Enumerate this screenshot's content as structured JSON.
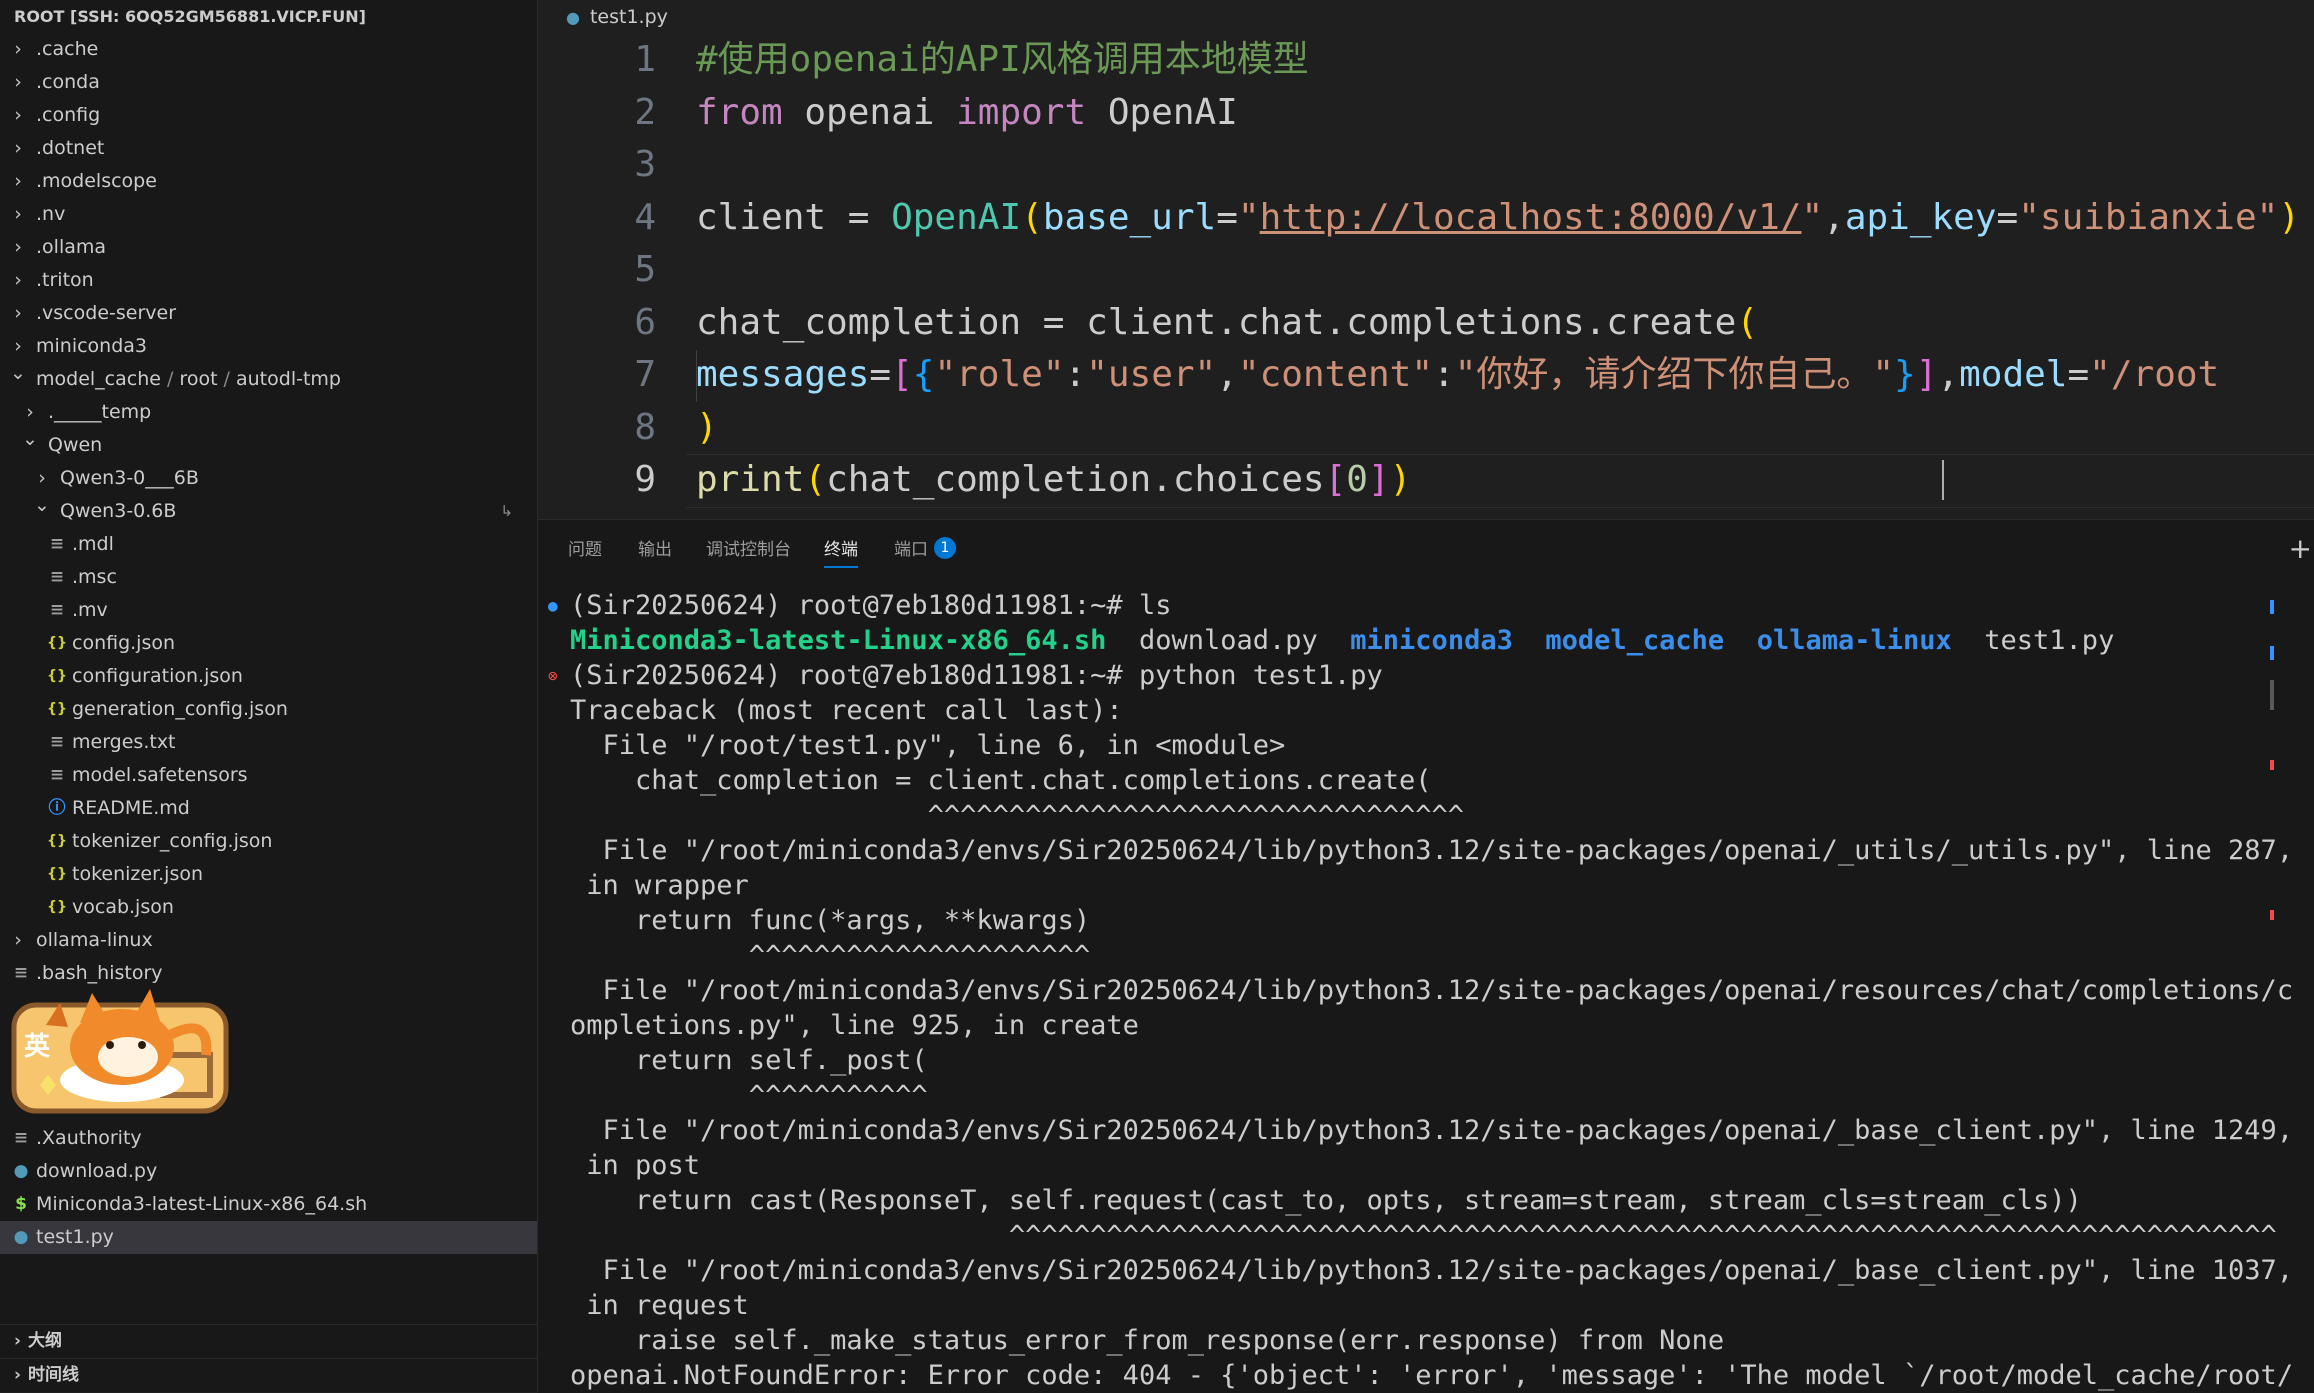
{
  "explorer": {
    "title": "ROOT [SSH: 6OQ52GM56881.VICP.FUN]",
    "items": [
      {
        "label": ".cache",
        "kind": "folder",
        "expanded": false,
        "depth": 0
      },
      {
        "label": ".conda",
        "kind": "folder",
        "expanded": false,
        "depth": 0
      },
      {
        "label": ".config",
        "kind": "folder",
        "expanded": false,
        "depth": 0
      },
      {
        "label": ".dotnet",
        "kind": "folder",
        "expanded": false,
        "depth": 0
      },
      {
        "label": ".modelscope",
        "kind": "folder",
        "expanded": false,
        "depth": 0
      },
      {
        "label": ".nv",
        "kind": "folder",
        "expanded": false,
        "depth": 0
      },
      {
        "label": ".ollama",
        "kind": "folder",
        "expanded": false,
        "depth": 0
      },
      {
        "label": ".triton",
        "kind": "folder",
        "expanded": false,
        "depth": 0
      },
      {
        "label": ".vscode-server",
        "kind": "folder",
        "expanded": false,
        "depth": 0
      },
      {
        "label": "miniconda3",
        "kind": "folder",
        "expanded": false,
        "depth": 0
      },
      {
        "label": "model_cache",
        "kind": "folder",
        "expanded": true,
        "depth": 0,
        "suffix_parts": [
          "/",
          "root",
          "/",
          "autodl-tmp"
        ]
      },
      {
        "label": "._____temp",
        "kind": "folder",
        "expanded": false,
        "depth": 1
      },
      {
        "label": "Qwen",
        "kind": "folder",
        "expanded": true,
        "depth": 1
      },
      {
        "label": "Qwen3-0___6B",
        "kind": "folder",
        "expanded": false,
        "depth": 2
      },
      {
        "label": "Qwen3-0.6B",
        "kind": "folder",
        "expanded": true,
        "depth": 2,
        "badge": "↳"
      },
      {
        "label": ".mdl",
        "kind": "lines",
        "depth": 3
      },
      {
        "label": ".msc",
        "kind": "lines",
        "depth": 3
      },
      {
        "label": ".mv",
        "kind": "lines",
        "depth": 3
      },
      {
        "label": "config.json",
        "kind": "json",
        "depth": 3
      },
      {
        "label": "configuration.json",
        "kind": "json",
        "depth": 3
      },
      {
        "label": "generation_config.json",
        "kind": "json",
        "depth": 3
      },
      {
        "label": "merges.txt",
        "kind": "lines",
        "depth": 3
      },
      {
        "label": "model.safetensors",
        "kind": "lines",
        "depth": 3
      },
      {
        "label": "README.md",
        "kind": "info",
        "depth": 3
      },
      {
        "label": "tokenizer_config.json",
        "kind": "json",
        "depth": 3
      },
      {
        "label": "tokenizer.json",
        "kind": "json",
        "depth": 3
      },
      {
        "label": "vocab.json",
        "kind": "json",
        "depth": 3
      },
      {
        "label": "ollama-linux",
        "kind": "folder",
        "expanded": false,
        "depth": 0
      },
      {
        "label": ".bash_history",
        "kind": "lines",
        "depth": 0
      },
      {
        "label": "",
        "kind": "hidden",
        "depth": 0
      },
      {
        "label": "",
        "kind": "hidden",
        "depth": 0
      },
      {
        "label": "",
        "kind": "hidden",
        "depth": 0
      },
      {
        "label": "",
        "kind": "hidden",
        "depth": 0
      },
      {
        "label": ".Xauthority",
        "kind": "lines",
        "depth": 0
      },
      {
        "label": "download.py",
        "kind": "py",
        "depth": 0
      },
      {
        "label": "Miniconda3-latest-Linux-x86_64.sh",
        "kind": "sh",
        "depth": 0
      },
      {
        "label": "test1.py",
        "kind": "py",
        "depth": 0,
        "selected": true
      }
    ],
    "mascot_label": "英",
    "sections": [
      "大纲",
      "时间线"
    ]
  },
  "editor": {
    "tab": "test1.py",
    "lines": [
      {
        "n": "1",
        "tokens": [
          [
            "t-cm",
            "#使用openai的API风格调用本地模型"
          ]
        ]
      },
      {
        "n": "2",
        "tokens": [
          [
            "t-kw",
            "from"
          ],
          [
            "t-id",
            " openai "
          ],
          [
            "t-kw",
            "import"
          ],
          [
            "t-id",
            " OpenAI"
          ]
        ]
      },
      {
        "n": "3",
        "tokens": []
      },
      {
        "n": "4",
        "tokens": [
          [
            "t-id",
            "client = "
          ],
          [
            "t-cls",
            "OpenAI"
          ],
          [
            "b1",
            "("
          ],
          [
            "t-par",
            "base_url"
          ],
          [
            "t-id",
            "="
          ],
          [
            "t-str",
            "\""
          ],
          [
            "t-str url",
            "http://localhost:8000/v1/"
          ],
          [
            "t-str",
            "\""
          ],
          [
            "t-id",
            ","
          ],
          [
            "t-par",
            "api_key"
          ],
          [
            "t-id",
            "="
          ],
          [
            "t-str",
            "\"suibianxie\""
          ],
          [
            "b1",
            ")"
          ]
        ]
      },
      {
        "n": "5",
        "tokens": []
      },
      {
        "n": "6",
        "tokens": [
          [
            "t-id",
            "chat_completion = client.chat.completions.create"
          ],
          [
            "b1",
            "("
          ]
        ]
      },
      {
        "n": "7",
        "tokens": [
          [
            "t-id",
            "    "
          ],
          [
            "t-par",
            "messages"
          ],
          [
            "t-id",
            "="
          ],
          [
            "b2",
            "["
          ],
          [
            "b3",
            "{"
          ],
          [
            "t-str",
            "\"role\""
          ],
          [
            "t-id",
            ":"
          ],
          [
            "t-str",
            "\"user\""
          ],
          [
            "t-id",
            ","
          ],
          [
            "t-str",
            "\"content\""
          ],
          [
            "t-id",
            ":"
          ],
          [
            "t-str",
            "\"你好，请介绍下你自己。\""
          ],
          [
            "b3",
            "}"
          ],
          [
            "b2",
            "]"
          ],
          [
            "t-id",
            ","
          ],
          [
            "t-par",
            "model"
          ],
          [
            "t-id",
            "="
          ],
          [
            "t-str",
            "\"/root"
          ]
        ]
      },
      {
        "n": "8",
        "tokens": [
          [
            "b1",
            ")"
          ]
        ]
      },
      {
        "n": "9",
        "tokens": [
          [
            "t-fn",
            "print"
          ],
          [
            "b1",
            "("
          ],
          [
            "t-id",
            "chat_completion.choices"
          ],
          [
            "b2",
            "["
          ],
          [
            "t-num",
            "0"
          ],
          [
            "b2",
            "]"
          ],
          [
            "b1",
            ")"
          ]
        ],
        "active": true
      }
    ]
  },
  "panel": {
    "tabs": [
      "问题",
      "输出",
      "调试控制台",
      "终端",
      "端口"
    ],
    "active_tab": "终端",
    "ports_badge": "1",
    "terminal_lines": [
      {
        "dot": "blue",
        "segs": [
          [
            "",
            "(Sir20250624) root@7eb180d11981:~# ls"
          ]
        ]
      },
      {
        "segs": [
          [
            "g-green",
            "Miniconda3-latest-Linux-x86_64.sh"
          ],
          [
            "",
            "  download.py  "
          ],
          [
            "g-blue",
            "miniconda3"
          ],
          [
            "",
            "  "
          ],
          [
            "g-blue",
            "model_cache"
          ],
          [
            "",
            "  "
          ],
          [
            "g-blue",
            "ollama-linux"
          ],
          [
            "",
            "  test1.py"
          ]
        ]
      },
      {
        "dot": "red",
        "segs": [
          [
            "",
            "(Sir20250624) root@7eb180d11981:~# python test1.py"
          ]
        ]
      },
      {
        "segs": [
          [
            "",
            "Traceback (most recent call last):"
          ]
        ]
      },
      {
        "segs": [
          [
            "",
            "  File \"/root/test1.py\", line 6, in <module>"
          ]
        ]
      },
      {
        "segs": [
          [
            "",
            "    chat_completion = client.chat.completions.create("
          ]
        ]
      },
      {
        "segs": [
          [
            "",
            "                      ^^^^^^^^^^^^^^^^^^^^^^^^^^^^^^^^^"
          ]
        ]
      },
      {
        "segs": [
          [
            "",
            "  File \"/root/miniconda3/envs/Sir20250624/lib/python3.12/site-packages/openai/_utils/_utils.py\", line 287,"
          ]
        ]
      },
      {
        "segs": [
          [
            "",
            " in wrapper"
          ]
        ]
      },
      {
        "segs": [
          [
            "",
            "    return func(*args, **kwargs)"
          ]
        ]
      },
      {
        "segs": [
          [
            "",
            "           ^^^^^^^^^^^^^^^^^^^^^"
          ]
        ]
      },
      {
        "segs": [
          [
            "",
            "  File \"/root/miniconda3/envs/Sir20250624/lib/python3.12/site-packages/openai/resources/chat/completions/c"
          ]
        ]
      },
      {
        "segs": [
          [
            "",
            "ompletions.py\", line 925, in create"
          ]
        ]
      },
      {
        "segs": [
          [
            "",
            "    return self._post("
          ]
        ]
      },
      {
        "segs": [
          [
            "",
            "           ^^^^^^^^^^^"
          ]
        ]
      },
      {
        "segs": [
          [
            "",
            "  File \"/root/miniconda3/envs/Sir20250624/lib/python3.12/site-packages/openai/_base_client.py\", line 1249,"
          ]
        ]
      },
      {
        "segs": [
          [
            "",
            " in post"
          ]
        ]
      },
      {
        "segs": [
          [
            "",
            "    return cast(ResponseT, self.request(cast_to, opts, stream=stream, stream_cls=stream_cls))"
          ]
        ]
      },
      {
        "segs": [
          [
            "",
            "                           ^^^^^^^^^^^^^^^^^^^^^^^^^^^^^^^^^^^^^^^^^^^^^^^^^^^^^^^^^^^^^^^^^^^^^^^^^^^^^^"
          ]
        ]
      },
      {
        "segs": [
          [
            "",
            "  File \"/root/miniconda3/envs/Sir20250624/lib/python3.12/site-packages/openai/_base_client.py\", line 1037,"
          ]
        ]
      },
      {
        "segs": [
          [
            "",
            " in request"
          ]
        ]
      },
      {
        "segs": [
          [
            "",
            "    raise self._make_status_error_from_response(err.response) from None"
          ]
        ]
      },
      {
        "segs": [
          [
            "",
            "openai.NotFoundError: Error code: 404 - {'object': 'error', 'message': 'The model `/root/model_cache/root/"
          ]
        ]
      }
    ]
  }
}
